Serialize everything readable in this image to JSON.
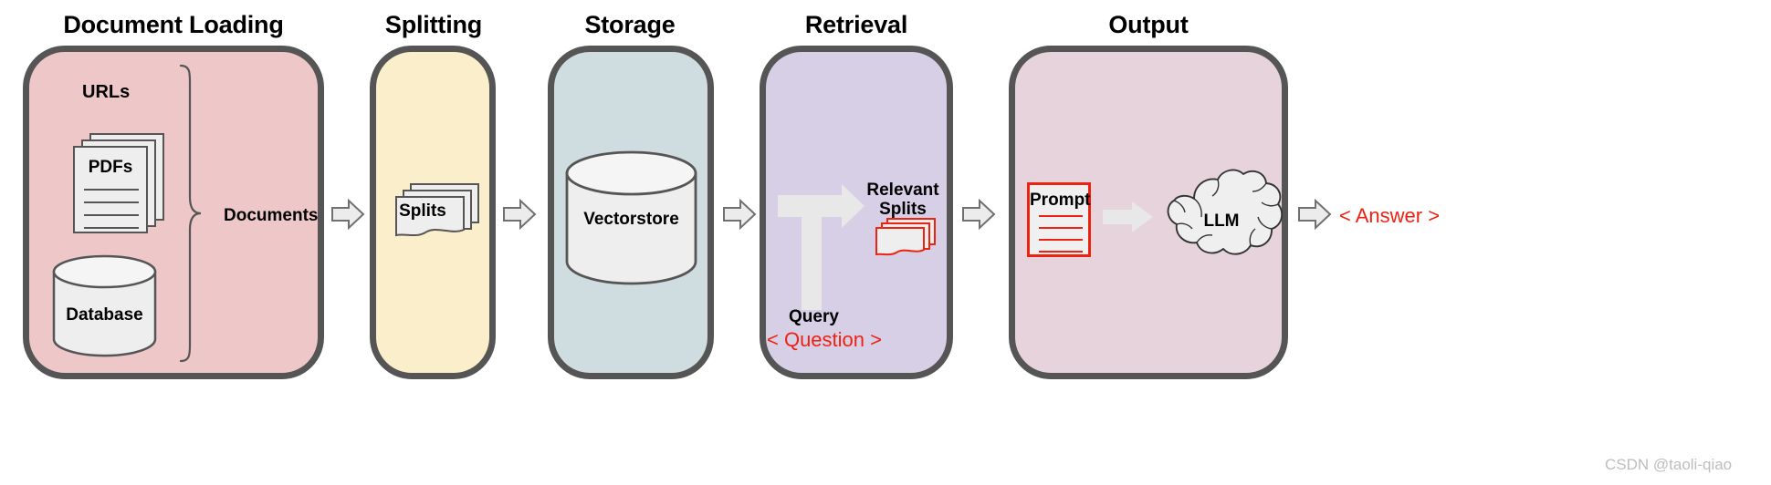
{
  "diagram": {
    "title_row": [
      {
        "label": "Document Loading"
      },
      {
        "label": "Splitting"
      },
      {
        "label": "Storage"
      },
      {
        "label": "Retrieval"
      },
      {
        "label": "Output"
      }
    ],
    "watermark": "CSDN @taoli-qiao"
  },
  "stages": {
    "document_loading": {
      "title": "Document Loading",
      "panel_color": "#eec8c8",
      "urls_label": "URLs",
      "pdfs_label": "PDFs",
      "database_label": "Database",
      "documents_label": "Documents"
    },
    "splitting": {
      "title": "Splitting",
      "panel_color": "#fbeecb",
      "splits_label": "Splits"
    },
    "storage": {
      "title": "Storage",
      "panel_color": "#cfdce0",
      "vectorstore_label": "Vectorstore"
    },
    "retrieval": {
      "title": "Retrieval",
      "panel_color": "#d6cfe6",
      "relevant_label_line1": "Relevant",
      "relevant_label_line2": "Splits",
      "query_label": "Query",
      "question_label": "< Question >"
    },
    "output": {
      "title": "Output",
      "panel_color": "#e6d3dc",
      "prompt_label": "Prompt",
      "llm_label": "LLM",
      "answer_label": "< Answer >"
    }
  },
  "colors": {
    "panel_border": "#555555",
    "arrow_fill": "#ececec",
    "arrow_stroke": "#707070",
    "accent_red": "#ee2211",
    "shape_fill": "#eeeeee",
    "shape_stroke": "#555555",
    "big_arrow_fill": "#e8e8e8",
    "watermark_gray": "#bdbdbd"
  },
  "icons": {
    "connector": "right-arrow-icon",
    "documents": "document-stack-icon",
    "database": "cylinder-database-icon",
    "vectorstore": "cylinder-database-icon",
    "retrieval_flow": "t-shaped-arrow-icon",
    "llm": "cloud-icon",
    "brace": "curly-brace-icon"
  }
}
